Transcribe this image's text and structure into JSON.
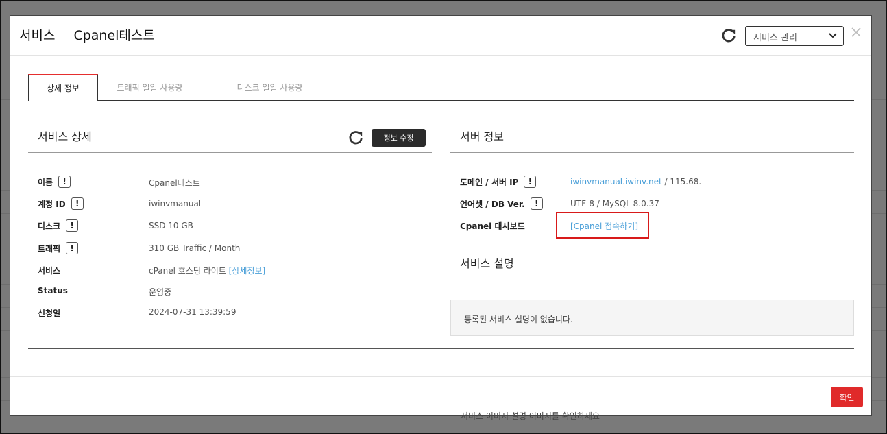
{
  "modal": {
    "title_prefix": "서비스",
    "title_name": "Cpanel테스트",
    "service_select": "서비스 관리",
    "ok_label": "확인"
  },
  "tabs": [
    {
      "label": "상세 정보",
      "active": true
    },
    {
      "label": "트래픽 일일 사용량",
      "active": false
    },
    {
      "label": "디스크 일일 사용량",
      "active": false
    }
  ],
  "service_detail": {
    "title": "서비스 상세",
    "edit_label": "정보 수정",
    "rows": [
      {
        "label": "이름",
        "value": "Cpanel테스트"
      },
      {
        "label": "계정 ID",
        "value": "iwinvmanual"
      },
      {
        "label": "디스크",
        "value": "SSD 10 GB"
      },
      {
        "label": "트래픽",
        "value": "310 GB Traffic / Month"
      },
      {
        "label": "서비스",
        "value": "cPanel 호스팅 라이트",
        "link": "[상세정보]"
      },
      {
        "label": "Status",
        "value": "운영중"
      },
      {
        "label": "신청일",
        "value": "2024-07-31 13:39:59"
      }
    ]
  },
  "server_info": {
    "title": "서버 정보",
    "domain_label": "도메인 / 서버 IP",
    "domain_link": "iwinvmanual.iwinv.net",
    "domain_ip": " / 115.68.",
    "lang_label": "언어셋 / DB Ver.",
    "lang_value": "UTF-8 / MySQL 8.0.37",
    "cpanel_label": "Cpanel 대시보드",
    "cpanel_link": "[Cpanel 접속하기]"
  },
  "service_desc": {
    "title": "서비스 설명",
    "text": "등록된 서비스 설명이 없습니다."
  },
  "background": {
    "text": "서비스 이미지 설명 이미지를 확인하세요"
  },
  "colors": {
    "accent": "#e02a2a",
    "link": "#4a9fd8",
    "highlight": "#d81a1a"
  }
}
